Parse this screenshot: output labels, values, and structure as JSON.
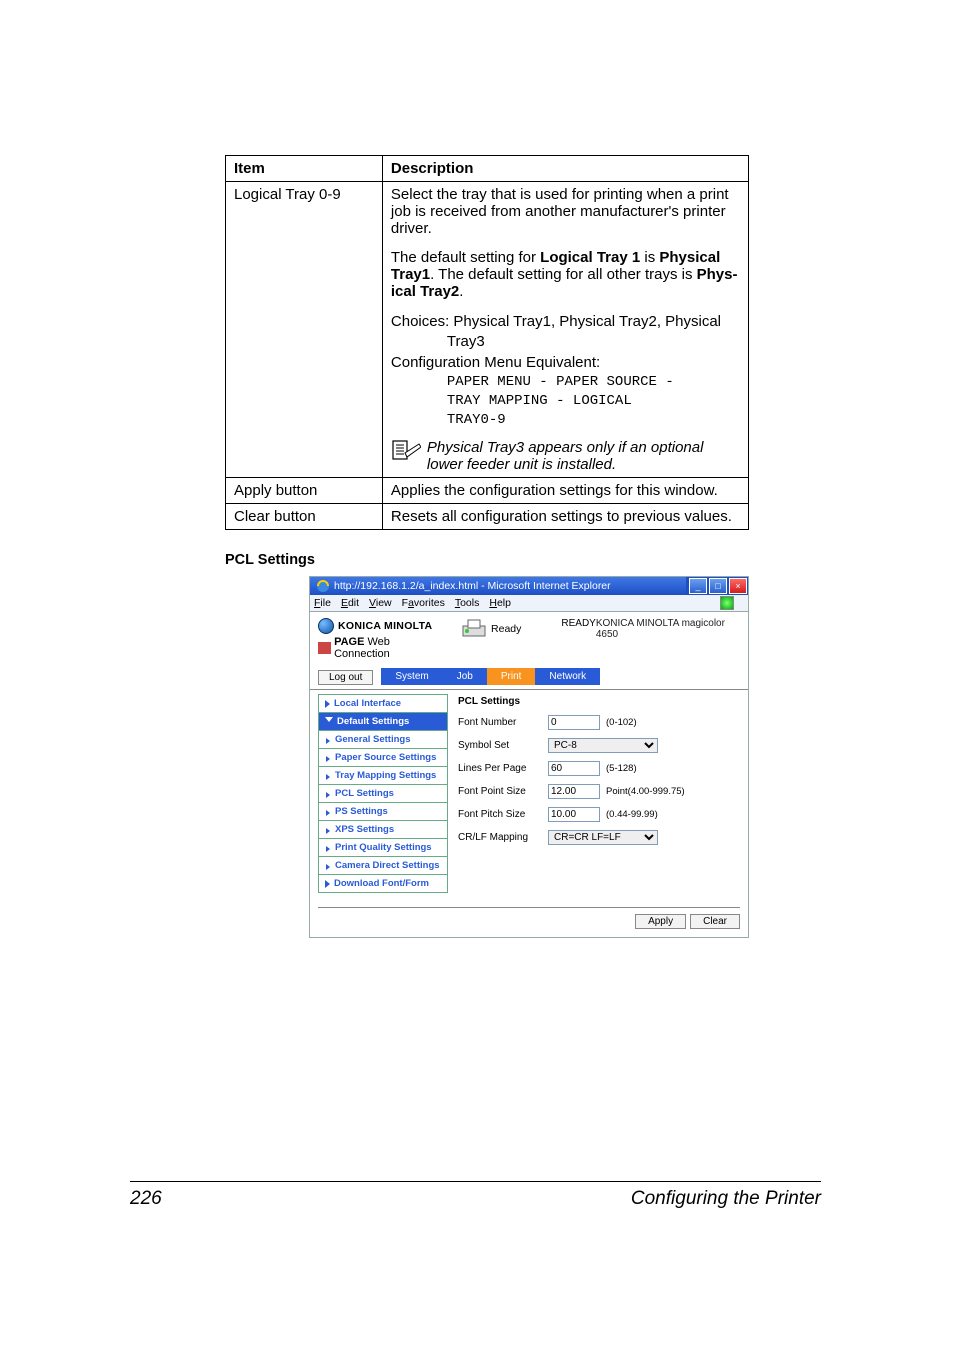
{
  "table": {
    "headers": {
      "item": "Item",
      "desc": "Description"
    },
    "rows": {
      "logical_tray": {
        "item": "Logical Tray 0-9",
        "p1": "Select the tray that is used for printing when a print job is received from another manufacturer's printer driver.",
        "p2a": "The default setting for ",
        "p2b": "Logical Tray 1",
        "p2c": " is ",
        "p2d": "Physical Tray1",
        "p2e": ". The default setting for all other trays is ",
        "p2f": "Phys-ical Tray2",
        "p2g": ".",
        "choices1": "Choices: Physical Tray1, Physical Tray2, Physical",
        "choices2": "Tray3",
        "cfg_eq": "Configuration Menu Equivalent:",
        "mono1": "PAPER MENU - PAPER SOURCE -",
        "mono2": "TRAY MAPPING - LOGICAL",
        "mono3": "TRAY0-9",
        "note_a": "Physical Tray3 appears only if an optional ",
        "note_b": "lower feeder unit is installed."
      },
      "apply": {
        "item": "Apply button",
        "desc": "Applies the configuration settings for this window."
      },
      "clear": {
        "item": "Clear button",
        "desc": "Resets all configuration settings to previous values."
      }
    }
  },
  "section_heading": "PCL Settings",
  "screenshot": {
    "window_title": "http://192.168.1.2/a_index.html - Microsoft Internet Explorer",
    "menu": [
      "File",
      "Edit",
      "View",
      "Favorites",
      "Tools",
      "Help"
    ],
    "brand": "KONICA MINOLTA",
    "brand2a": "PAGE",
    "brand2b": " Web Connection",
    "status_label": "Ready",
    "status_big": "READY",
    "device": "KONICA MINOLTA magicolor 4650",
    "logout": "Log out",
    "tabs": [
      "System",
      "Job",
      "Print",
      "Network"
    ],
    "active_tab": "Print",
    "nav": {
      "local_interface": "Local Interface",
      "default_settings": "Default Settings",
      "subs": [
        "General Settings",
        "Paper Source Settings",
        "Tray Mapping Settings",
        "PCL Settings",
        "PS Settings",
        "XPS Settings",
        "Print Quality Settings",
        "Camera Direct Settings"
      ],
      "download": "Download Font/Form"
    },
    "form": {
      "title": "PCL Settings",
      "rows": [
        {
          "label": "Font Number",
          "value": "0",
          "hint": "(0-102)",
          "type": "text"
        },
        {
          "label": "Symbol Set",
          "value": "PC-8",
          "type": "select"
        },
        {
          "label": "Lines Per Page",
          "value": "60",
          "hint": "(5-128)",
          "type": "text"
        },
        {
          "label": "Font Point Size",
          "value": "12.00",
          "hint": "Point(4.00-999.75)",
          "type": "text"
        },
        {
          "label": "Font Pitch Size",
          "value": "10.00",
          "hint": "(0.44-99.99)",
          "type": "text"
        },
        {
          "label": "CR/LF Mapping",
          "value": "CR=CR LF=LF",
          "type": "select"
        }
      ],
      "apply": "Apply",
      "clear": "Clear"
    }
  },
  "footer": {
    "page": "226",
    "text": "Configuring the Printer"
  }
}
